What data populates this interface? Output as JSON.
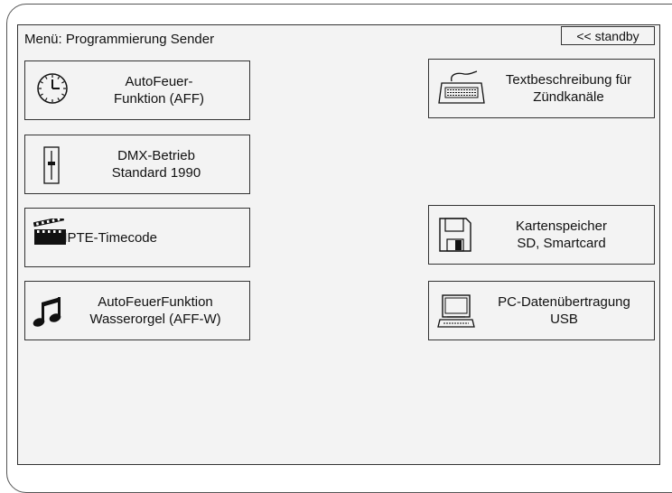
{
  "menu": {
    "title": "Menü: Programmierung Sender",
    "standby_label": "<< standby"
  },
  "buttons": {
    "aff": {
      "line1": "AutoFeuer-",
      "line2": "Funktion (AFF)",
      "icon": "clock-icon"
    },
    "dmx": {
      "line1": "DMX-Betrieb",
      "line2": "Standard 1990",
      "icon": "fader-icon"
    },
    "smpte": {
      "line1": "SMPTE-Timecode",
      "icon": "clapperboard-icon"
    },
    "affw": {
      "line1": "AutoFeuerFunktion",
      "line2": "Wasserorgel (AFF-W)",
      "icon": "music-note-icon"
    },
    "text": {
      "line1": "Textbeschreibung für",
      "line2": "Zündkanäle",
      "icon": "keyboard-icon"
    },
    "card": {
      "line1": "Kartenspeicher",
      "line2": "SD, Smartcard",
      "icon": "floppy-disk-icon"
    },
    "pc": {
      "line1": "PC-Datenübertragung",
      "line2": "USB",
      "icon": "computer-icon"
    }
  }
}
